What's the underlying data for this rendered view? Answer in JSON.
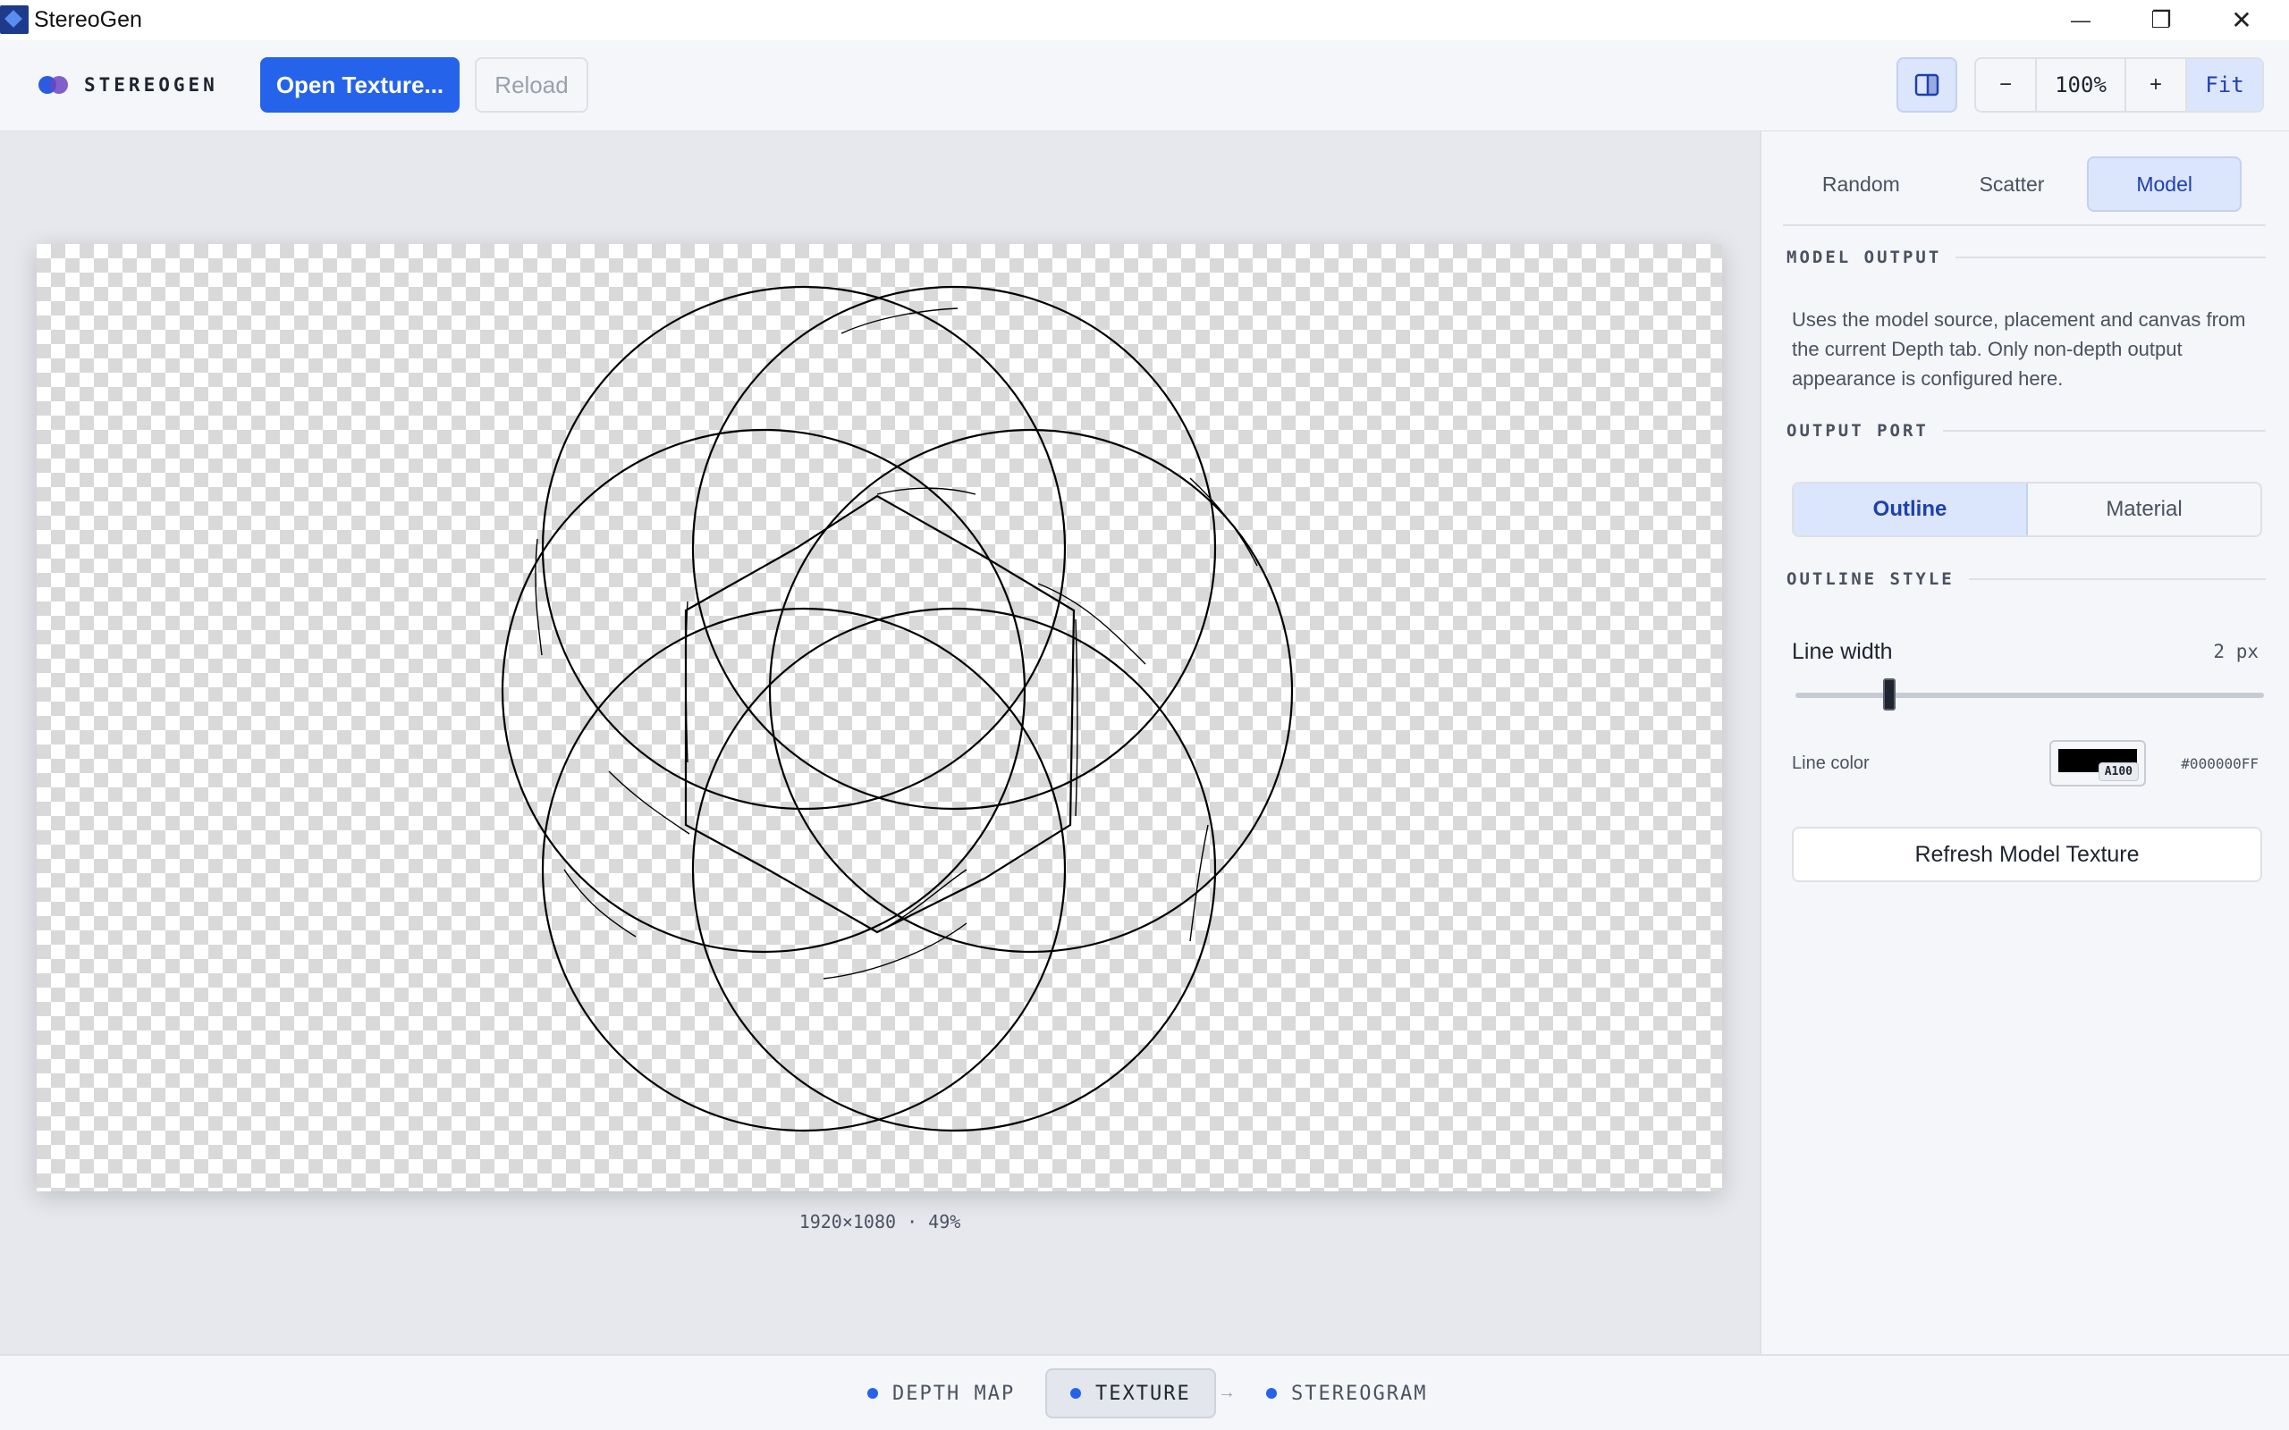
{
  "window": {
    "title": "StereoGen",
    "minimize_glyph": "—",
    "maximize_glyph": "❐",
    "close_glyph": "✕"
  },
  "toolbar": {
    "brand": "STEREOGEN",
    "open_texture": "Open Texture...",
    "reload": "Reload",
    "zoom_out": "−",
    "zoom_level": "100%",
    "zoom_in": "+",
    "fit": "Fit"
  },
  "canvas": {
    "caption": "1920×1080 · 49%"
  },
  "panel": {
    "tabs": [
      {
        "label": "Random",
        "active": false
      },
      {
        "label": "Scatter",
        "active": false
      },
      {
        "label": "Model",
        "active": true
      }
    ],
    "model_output": {
      "heading": "MODEL OUTPUT",
      "description": "Uses the model source, placement and canvas from the current Depth tab. Only non-depth output appearance is configured here."
    },
    "output_port": {
      "heading": "OUTPUT PORT",
      "options": [
        {
          "label": "Outline",
          "active": true
        },
        {
          "label": "Material",
          "active": false
        }
      ]
    },
    "outline_style": {
      "heading": "OUTLINE STYLE",
      "line_width_label": "Line width",
      "line_width_value": "2 px",
      "line_width_fraction": 0.2,
      "line_color_label": "Line color",
      "line_color_badge": "A100",
      "line_color_hex": "#000000FF",
      "line_color": "#000000"
    },
    "refresh_button": "Refresh Model Texture"
  },
  "pipeline": {
    "steps": [
      {
        "label": "DEPTH MAP",
        "active": false
      },
      {
        "label": "TEXTURE",
        "active": true
      },
      {
        "label": "STEREOGRAM",
        "active": false
      }
    ],
    "arrow": "→"
  },
  "colors": {
    "accent": "#2563eb",
    "accent_soft": "#dbe5fb",
    "accent_text": "#1e40af"
  }
}
